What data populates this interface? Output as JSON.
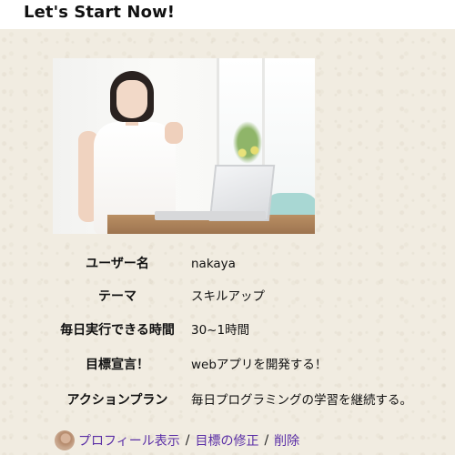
{
  "header": {
    "title": "Let's Start Now!"
  },
  "hero": {
    "image": "photo of smiling woman at laptop"
  },
  "profile": {
    "rows": [
      {
        "label": "ユーザー名",
        "value": "nakaya"
      },
      {
        "label": "テーマ",
        "value": "スキルアップ"
      },
      {
        "label": "毎日実行できる時間",
        "value": "30~1時間"
      },
      {
        "label": "目標宣言！",
        "value": "webアプリを開発する！"
      },
      {
        "label": "アクションプラン",
        "value": "毎日プログラミングの学習を継続する。"
      }
    ]
  },
  "actions": {
    "profile_link": "プロフィール表示",
    "edit_link": "目標の修正",
    "delete_link": "削除",
    "separator": "/",
    "link_color": "#5a2ea6"
  }
}
